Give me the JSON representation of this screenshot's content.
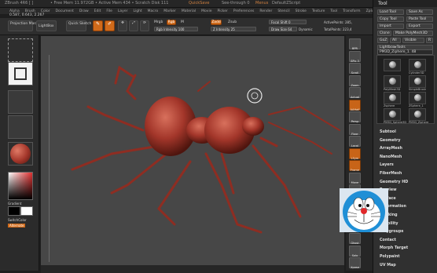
{
  "titlebar": {
    "left_text": "ZBrush 4R6 [ ]",
    "center_text": "• Free Mem 11.972GB • Active Mem 434 • Scratch Disk 111",
    "quicksave": "QuickSave",
    "see_through": "See-through 0",
    "menus": "Menus",
    "default_script": "DefaultZScript"
  },
  "menu_items": [
    "Alpha",
    "Brush",
    "Color",
    "Document",
    "Draw",
    "Edit",
    "File",
    "Layer",
    "Light",
    "Macro",
    "Marker",
    "Material",
    "Movie",
    "Picker",
    "Preferences",
    "Render",
    "Stencil",
    "Stroke",
    "Texture",
    "Tool",
    "Transform",
    "Zplugin",
    "Zscript"
  ],
  "coords": "0.587, 0.643, 2.267",
  "toolbar": {
    "projection_master": "Projection Master",
    "lightbox": "LightBox",
    "quick_sketch": "Quick Sketch",
    "edit": "Edit",
    "draw": "Draw",
    "move": "Move",
    "scale": "Scale",
    "rotate": "Rotate",
    "mrgb": "Mrgb",
    "rgb": "Rgb",
    "m": "M",
    "rgb_intensity": "Rgb Intensity 100",
    "zadd": "Zadd",
    "zsub": "Zsub",
    "z_intensity": "Z Intensity 25",
    "focal_shift": "Focal Shift 0",
    "draw_size": "Draw Size 64",
    "dynamic": "Dynamic",
    "active_points": "ActivePoints: 285,",
    "total_points": "TotalPoints: 223,4"
  },
  "left": {
    "gradient": "Gradient",
    "switch_color": "SwitchColor",
    "alternate": "Alternate"
  },
  "shelf_icons": [
    "BPR",
    "SPix 3",
    "Scroll",
    "Zoom",
    "Actual",
    "AAHalf",
    "Persp",
    "Floor",
    "Local",
    "LSym",
    "Frame",
    "Move",
    "Scale",
    "Rotate",
    "PolyF",
    "Transp",
    "Ghost",
    "Solo",
    "Xpose"
  ],
  "tray": {
    "title": "Tool",
    "load_tool": "Load Tool",
    "save_as": "Save As",
    "copy_tool": "Copy Tool",
    "paste_tool": "Paste Tool",
    "import": "Import",
    "export": "Export",
    "clone": "Clone",
    "make_polymesh": "Make PolyMesh3D",
    "goz": "GoZ",
    "all": "All",
    "visible": "Visible",
    "r": "R",
    "lightbox_tools": "Lightbox▸Tools",
    "current_tool": "PM3D_Ziphere_1. 48",
    "tools": [
      {
        "label": "",
        "icon": "sphere-tool-icon"
      },
      {
        "label": "Cylinder3D",
        "icon": "cylinder-tool-icon"
      },
      {
        "label": "PolyMesh3D",
        "icon": "polymesh-star-icon"
      },
      {
        "label": "SimpleBrush",
        "icon": "simplebrush-icon"
      },
      {
        "label": "Zsphere",
        "icon": "zsphere-icon"
      },
      {
        "label": "ZSphere_1",
        "icon": "zsphere-icon"
      },
      {
        "label": "PM3D_Sphere3D",
        "icon": "sphere-tool-icon"
      },
      {
        "label": "PM3D_Ziphere",
        "icon": "pm3d-icon"
      }
    ],
    "subpalettes": [
      "Subtool",
      "Geometry",
      "ArrayMesh",
      "NanoMesh",
      "Layers",
      "FiberMesh",
      "Geometry HD",
      "Preview",
      "Surface",
      "Deformation",
      "Masking",
      "Visibility",
      "Polygroups",
      "Contact",
      "Morph Target",
      "Polypaint",
      "UV Map"
    ]
  },
  "colors": {
    "accent": "#d06a1a",
    "model": "#a3362a",
    "panel": "#303030",
    "viewport": "#474747"
  }
}
